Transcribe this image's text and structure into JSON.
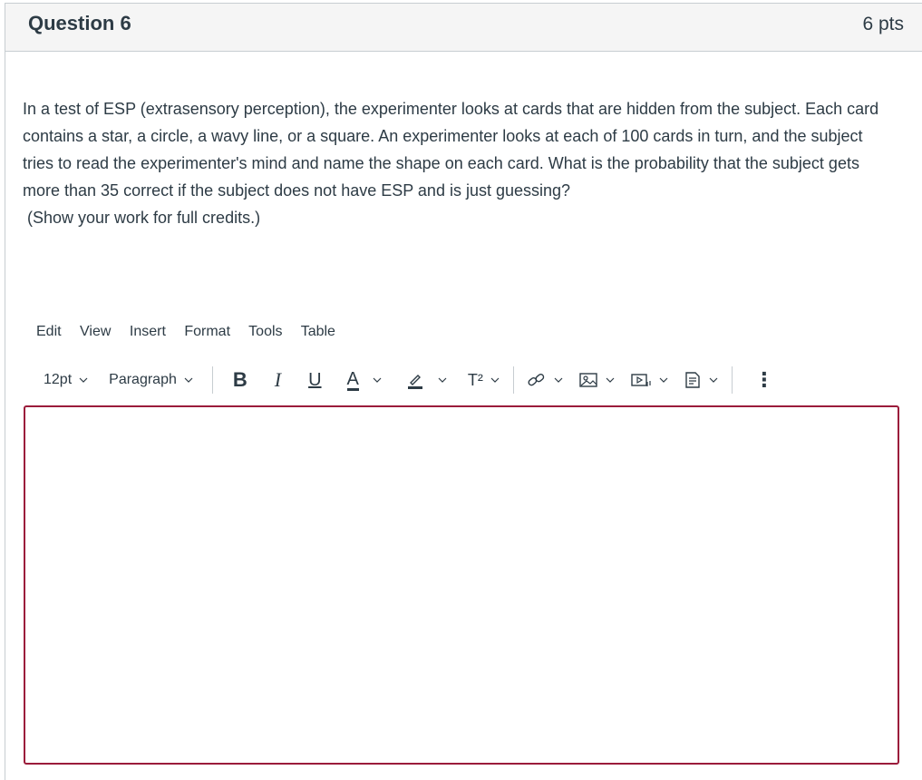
{
  "question": {
    "title": "Question 6",
    "points": "6 pts",
    "text": "In a test of ESP (extrasensory perception), the experimenter looks at cards that are hidden from the subject. Each card contains a star, a circle, a wavy line, or a square. An experimenter looks at each of 100 cards in turn, and the subject tries to read the experimenter's mind and name the shape on each card. What is the probability that the subject gets more than 35 correct if the subject does not have ESP and is just guessing?",
    "note": "(Show your work for full credits.)"
  },
  "menubar": {
    "items": [
      "Edit",
      "View",
      "Insert",
      "Format",
      "Tools",
      "Table"
    ]
  },
  "toolbar": {
    "font_size": "12pt",
    "block_format": "Paragraph",
    "bold_label": "B",
    "italic_label": "I",
    "underline_label": "U",
    "text_color_label": "A",
    "superscript_label": "T²",
    "more_label": "⋮",
    "icons": [
      "bold-icon",
      "italic-icon",
      "underline-icon",
      "text-color-icon",
      "highlight-icon",
      "superscript-icon",
      "link-icon",
      "image-icon",
      "media-icon",
      "document-icon",
      "more-icon"
    ]
  },
  "editor": {
    "value": "",
    "border_color": "#9b1c3b"
  }
}
